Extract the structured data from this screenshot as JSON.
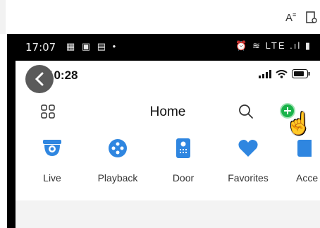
{
  "browser": {
    "icons": [
      "text-size-icon",
      "page-icon"
    ]
  },
  "device_status": {
    "time": "17:07",
    "glyphs": "▦ ▣ ▤ •",
    "right": "⏰ ≋ LTE .ıl ▮"
  },
  "app": {
    "ios_time": "10:28",
    "title": "Home",
    "shortcuts": [
      {
        "label": "Live",
        "icon": "camera-icon"
      },
      {
        "label": "Playback",
        "icon": "playback-icon"
      },
      {
        "label": "Door",
        "icon": "door-icon"
      },
      {
        "label": "Favorites",
        "icon": "heart-icon"
      },
      {
        "label": "Acce",
        "icon": "access-icon"
      }
    ]
  },
  "colors": {
    "accent": "#2f86e0",
    "add_button": "#19b34a"
  }
}
